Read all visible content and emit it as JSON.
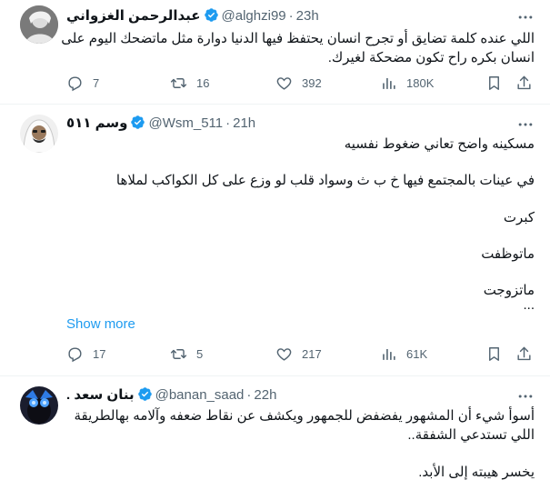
{
  "tweets": [
    {
      "name": "عبدالرحمن الغزواني",
      "handle": "@alghzi99",
      "time": "23h",
      "lines": [
        "اللي عنده كلمة تضايق أو تجرح انسان يحتفظ فيها الدنيا دوارة مثل ماتضحك اليوم على",
        "انسان بكره راح تكون مضحكة لغيرك."
      ],
      "replies": "7",
      "reposts": "16",
      "likes": "392",
      "views": "180K"
    },
    {
      "name": "وسم ٥١١",
      "handle": "@Wsm_511",
      "time": "21h",
      "lines": [
        "مسكينه واضح تعاني ضغوط نفسيه",
        "في عينات بالمجتمع فيها خ ب ث وسواد قلب لو وزع على كل الكواكب لملاها",
        "كبرت",
        "ماتوظفت",
        "ماتزوجت",
        "..."
      ],
      "show_more": "Show more",
      "replies": "17",
      "reposts": "5",
      "likes": "217",
      "views": "61K"
    },
    {
      "name": ". بنان سعد",
      "handle": "@banan_saad",
      "time": "22h",
      "lines": [
        "أسوأ شيء أن المشهور يفضفض للجمهور ويكشف عن نقاط ضعفه وآلامه بهالطريقة",
        "اللي تستدعي الشفقة..",
        "يخسر هيبته إلى الأبد."
      ]
    }
  ],
  "separator": "·",
  "colors": {
    "verified": "#1d9bf0",
    "muted": "#536471",
    "link": "#1d9bf0",
    "text": "#0f1419"
  },
  "icons": {
    "reply": "reply-icon",
    "repost": "repost-icon",
    "like": "heart-icon",
    "views": "views-icon",
    "bookmark": "bookmark-icon",
    "share": "share-icon",
    "more": "more-icon"
  }
}
